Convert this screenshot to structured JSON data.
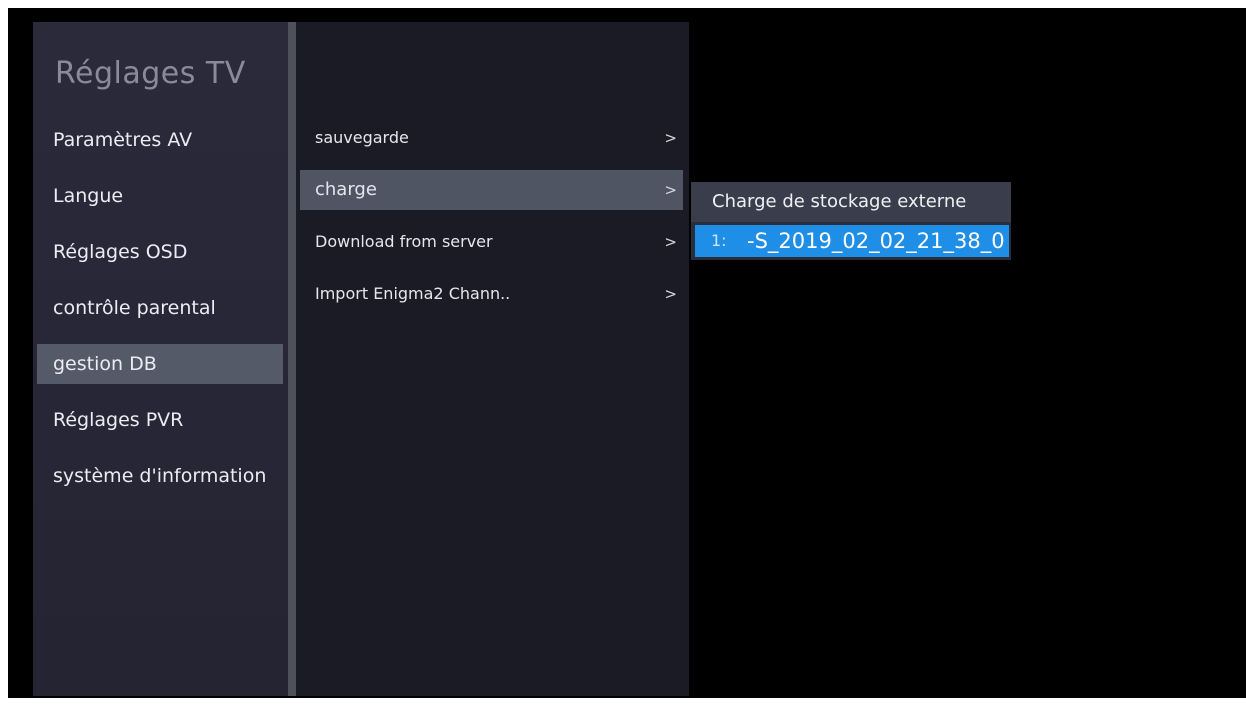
{
  "sidebar": {
    "title": "Réglages TV",
    "items": [
      {
        "label": "Paramètres AV"
      },
      {
        "label": "Langue"
      },
      {
        "label": "Réglages OSD"
      },
      {
        "label": "contrôle parental"
      },
      {
        "label": "gestion DB"
      },
      {
        "label": "Réglages PVR"
      },
      {
        "label": "système d'information"
      }
    ],
    "selected": "gestion DB"
  },
  "submenu": {
    "items": [
      {
        "label": "sauvegarde",
        "chevron": ">"
      },
      {
        "label": "charge",
        "chevron": ">"
      },
      {
        "label": "Download from server",
        "chevron": ">"
      },
      {
        "label": "Import Enigma2 Chann..",
        "chevron": ">"
      }
    ],
    "selected": "charge"
  },
  "popup": {
    "title": "Charge de stockage externe",
    "files": [
      {
        "index": "1:",
        "name": "-S_2019_02_02_21_38_0"
      }
    ]
  },
  "colors": {
    "sidebar_bg": "#262636",
    "submenu_bg": "#1b1b26",
    "selection_bg": "#545a68",
    "file_highlight": "#1f8ee6",
    "screen_bg": "#000000"
  }
}
